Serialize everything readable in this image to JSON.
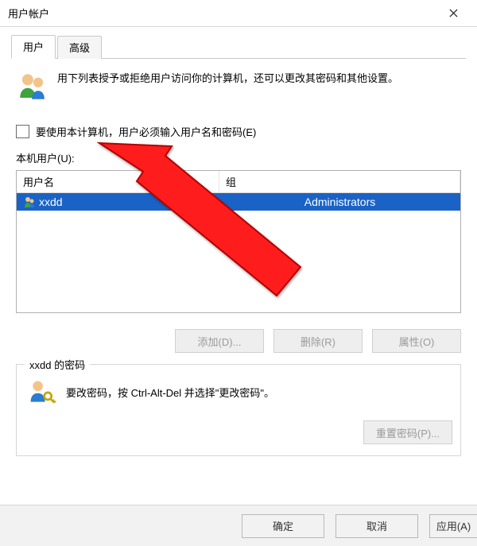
{
  "window": {
    "title": "用户帐户"
  },
  "tabs": [
    "用户",
    "高级"
  ],
  "intro": "用下列表授予或拒绝用户访问你的计算机，还可以更改其密码和其他设置。",
  "checkbox_label": "要使用本计算机，用户必须输入用户名和密码(E)",
  "list_label": "本机用户(U):",
  "columns": {
    "user": "用户名",
    "group": "组"
  },
  "rows": [
    {
      "user": "xxdd",
      "group": "Administrators"
    }
  ],
  "buttons": {
    "add": "添加(D)...",
    "remove": "删除(R)",
    "props": "属性(O)"
  },
  "password_box": {
    "legend": "xxdd 的密码",
    "text": "要改密码，按 Ctrl-Alt-Del 并选择\"更改密码\"。",
    "reset": "重置密码(P)..."
  },
  "footer": {
    "ok": "确定",
    "cancel": "取消",
    "apply": "应用(A)"
  }
}
